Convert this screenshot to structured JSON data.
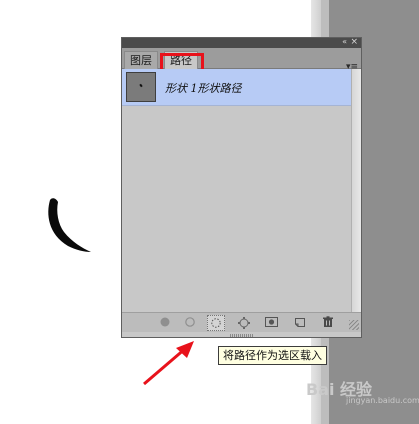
{
  "panel": {
    "collapse_icon": "«",
    "close_icon": "×",
    "tabs": [
      {
        "label": "图层",
        "active": false
      },
      {
        "label": "路径",
        "active": true
      }
    ],
    "menu_icon": "▾≡",
    "highlight_color": "#e8121b"
  },
  "paths": [
    {
      "name": "形状 1形状路径",
      "selected": true
    }
  ],
  "toolbar": {
    "tools": [
      "fill-path-icon",
      "stroke-path-icon",
      "load-selection-icon",
      "make-work-path-icon",
      "add-mask-icon",
      "new-path-icon",
      "delete-path-icon"
    ]
  },
  "tooltip": {
    "text": "将路径作为选区载入"
  },
  "watermark": {
    "text": "Bai 经验",
    "sub": "jingyan.baidu.com"
  },
  "colors": {
    "selected_row": "#b7cbf5",
    "panel_bg": "#c8c8c8",
    "arrow": "#e8121b"
  }
}
